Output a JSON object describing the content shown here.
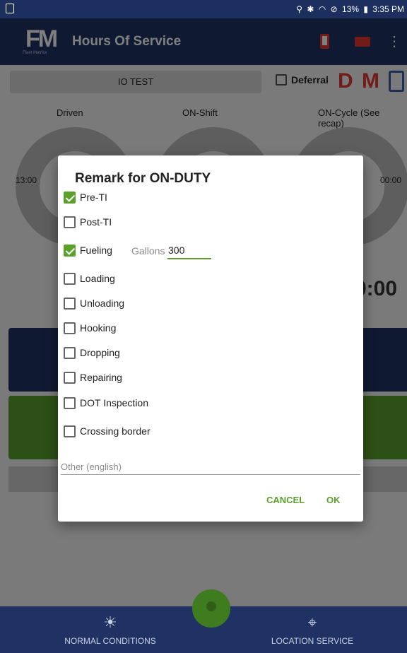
{
  "status_bar": {
    "icons": [
      "location-icon",
      "bluetooth-icon",
      "wifi-icon",
      "dnd-icon"
    ],
    "battery": "13%",
    "time": "3:35 PM"
  },
  "app_bar": {
    "logo_text": "FM",
    "logo_sub": "Fleet Metrikx",
    "title": "Hours Of Service",
    "more": "⋮"
  },
  "background": {
    "vehicle": "IO TEST",
    "deferral_label": "Deferral",
    "dm_d": "D",
    "dm_m": "M",
    "labels": {
      "driven": "Driven",
      "on_shift": "ON-Shift",
      "on_cycle": "ON-Cycle (See recap)"
    },
    "time_left": "13:00",
    "time_right": "00:00",
    "big_time": "0:00"
  },
  "bottom_bar": {
    "left_label": "NORMAL CONDITIONS",
    "right_label": "LOCATION SERVICE"
  },
  "dialog": {
    "title": "Remark for ON-DUTY",
    "options": [
      {
        "label": "Pre-TI",
        "checked": true
      },
      {
        "label": "Post-TI",
        "checked": false
      },
      {
        "label": "Fueling",
        "checked": true
      },
      {
        "label": "Loading",
        "checked": false
      },
      {
        "label": "Unloading",
        "checked": false
      },
      {
        "label": "Hooking",
        "checked": false
      },
      {
        "label": "Dropping",
        "checked": false
      },
      {
        "label": "Repairing",
        "checked": false
      },
      {
        "label": "DOT Inspection",
        "checked": false
      },
      {
        "label": "Crossing border",
        "checked": false
      }
    ],
    "gallons_label": "Gallons",
    "gallons_value": "300",
    "other_placeholder": "Other (english)",
    "cancel": "CANCEL",
    "ok": "OK"
  },
  "colors": {
    "primary": "#1f3263",
    "accent": "#5aa12c",
    "alert": "#e53935"
  }
}
